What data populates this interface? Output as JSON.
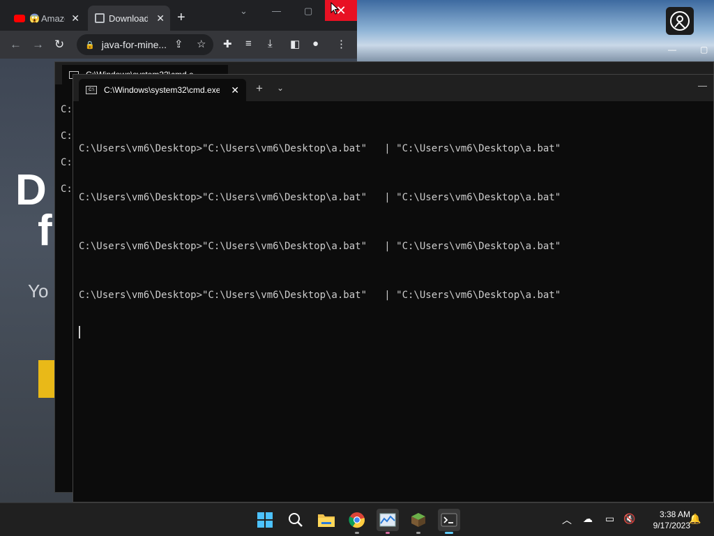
{
  "chrome": {
    "tabs": [
      {
        "label": "Amazon",
        "favicon": "youtube-icon"
      },
      {
        "label": "Download",
        "favicon": "box-icon"
      }
    ],
    "new_tab": "+",
    "url": "java-for-mine...",
    "close_color": "#e81123"
  },
  "page": {
    "hero_title_line1": "D",
    "hero_title_line2": "f",
    "hero_subtitle": "Yo",
    "accent": "#e9b918"
  },
  "cmd_back": {
    "tab_title": "C:\\Windows\\system32\\cmd.e",
    "lines": [
      "C:",
      "C:",
      "C:",
      "C:"
    ]
  },
  "terminal": {
    "tab_title": "C:\\Windows\\system32\\cmd.exe",
    "add_tab": "+",
    "lines": [
      "C:\\Users\\vm6\\Desktop>\"C:\\Users\\vm6\\Desktop\\a.bat\"   | \"C:\\Users\\vm6\\Desktop\\a.bat\"",
      "C:\\Users\\vm6\\Desktop>\"C:\\Users\\vm6\\Desktop\\a.bat\"   | \"C:\\Users\\vm6\\Desktop\\a.bat\"",
      "C:\\Users\\vm6\\Desktop>\"C:\\Users\\vm6\\Desktop\\a.bat\"   | \"C:\\Users\\vm6\\Desktop\\a.bat\"",
      "C:\\Users\\vm6\\Desktop>\"C:\\Users\\vm6\\Desktop\\a.bat\"   | \"C:\\Users\\vm6\\Desktop\\a.bat\""
    ],
    "background": "#0c0c0c"
  },
  "taskbar": {
    "apps": [
      "windows-start-icon",
      "search-icon",
      "file-explorer-icon",
      "chrome-icon",
      "task-manager-icon",
      "minecraft-icon",
      "terminal-icon"
    ],
    "time": "3:38 AM",
    "date": "9/17/2023"
  }
}
